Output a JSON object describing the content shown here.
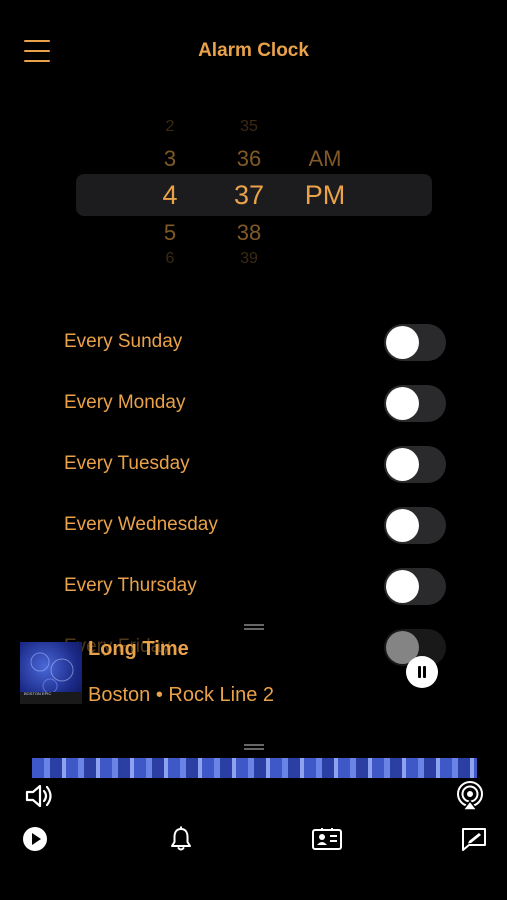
{
  "header": {
    "title": "Alarm Clock"
  },
  "picker": {
    "hours": [
      "2",
      "3",
      "4",
      "5",
      "6"
    ],
    "minutes": [
      "35",
      "36",
      "37",
      "38",
      "39"
    ],
    "periods": [
      "AM",
      "PM"
    ]
  },
  "days": [
    {
      "label": "Every Sunday",
      "on": false
    },
    {
      "label": "Every Monday",
      "on": false
    },
    {
      "label": "Every Tuesday",
      "on": false
    },
    {
      "label": "Every Wednesday",
      "on": false
    },
    {
      "label": "Every Thursday",
      "on": false
    },
    {
      "label": "Every Friday",
      "on": false
    }
  ],
  "now_playing": {
    "title": "Long Time",
    "subtitle": "Boston • Rock Line 2",
    "art_text": "BOSTON EPIC"
  },
  "icons": {
    "menu": "hamburger-icon",
    "volume": "speaker-icon",
    "airplay": "airplay-icon",
    "play": "play-icon",
    "alarm": "bell-icon",
    "contact": "contact-card-icon",
    "edit": "edit-icon"
  },
  "colors": {
    "accent": "#e9a24a",
    "background": "#000000"
  }
}
